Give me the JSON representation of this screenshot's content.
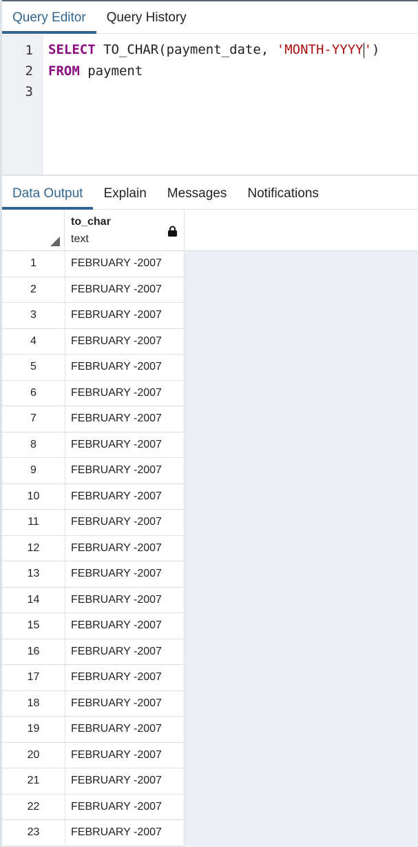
{
  "editor_tabs": [
    {
      "label": "Query Editor",
      "active": true
    },
    {
      "label": "Query History",
      "active": false
    }
  ],
  "editor": {
    "line_numbers": [
      "1",
      "2",
      "3"
    ],
    "line1": {
      "kw": "SELECT",
      "text": " TO_CHAR(payment_date, ",
      "str1": "'MONTH-YYYY",
      "str2": "'",
      ")": ")"
    },
    "line2": {
      "kw": "FROM",
      "text": " payment"
    }
  },
  "output_tabs": [
    {
      "label": "Data Output",
      "active": true
    },
    {
      "label": "Explain"
    },
    {
      "label": "Messages"
    },
    {
      "label": "Notifications"
    }
  ],
  "grid": {
    "column": {
      "name": "to_char",
      "type": "text"
    },
    "rows": [
      "FEBRUARY -2007",
      "FEBRUARY -2007",
      "FEBRUARY -2007",
      "FEBRUARY -2007",
      "FEBRUARY -2007",
      "FEBRUARY -2007",
      "FEBRUARY -2007",
      "FEBRUARY -2007",
      "FEBRUARY -2007",
      "FEBRUARY -2007",
      "FEBRUARY -2007",
      "FEBRUARY -2007",
      "FEBRUARY -2007",
      "FEBRUARY -2007",
      "FEBRUARY -2007",
      "FEBRUARY -2007",
      "FEBRUARY -2007",
      "FEBRUARY -2007",
      "FEBRUARY -2007",
      "FEBRUARY -2007",
      "FEBRUARY -2007",
      "FEBRUARY -2007",
      "FEBRUARY -2007"
    ]
  }
}
